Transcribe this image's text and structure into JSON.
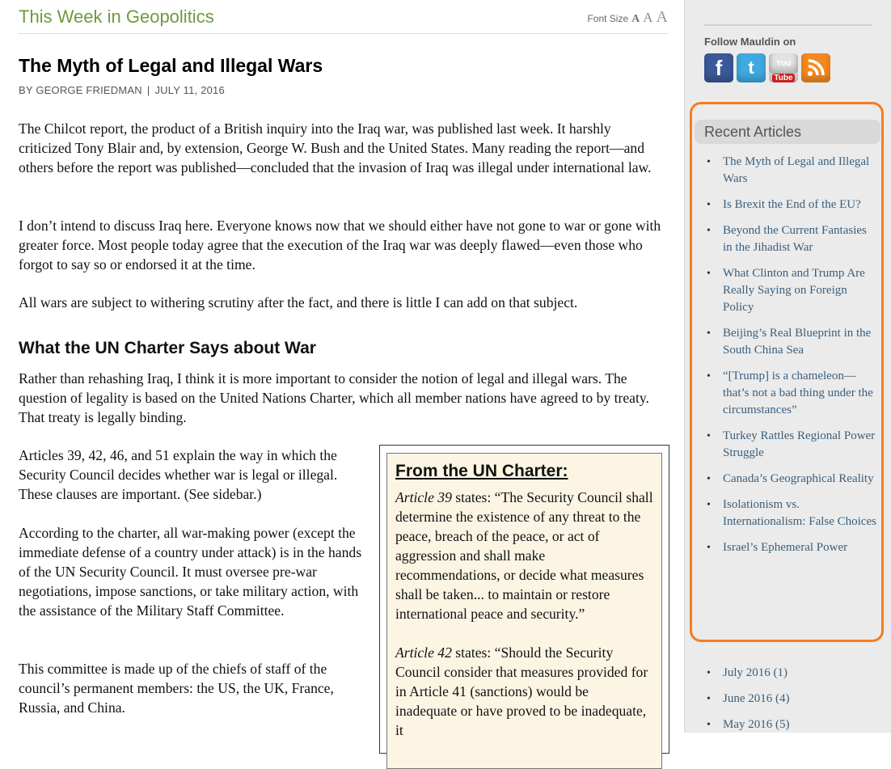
{
  "header": {
    "section_title": "This Week in Geopolitics",
    "font_size_label": "Font Size",
    "font_sizes": [
      "A",
      "A",
      "A"
    ]
  },
  "article": {
    "title": "The Myth of Legal and Illegal Wars",
    "author": "BY GEORGE FRIEDMAN",
    "date": "JULY 11, 2016",
    "paragraphs": [
      "The Chilcot report, the product of a British inquiry into the Iraq war, was published last week. It harshly criticized Tony Blair and, by extension, George W. Bush and the United States. Many reading the report—and others before the report was published—concluded that the invasion of Iraq was illegal under international law.",
      "I don’t intend to discuss Iraq here. Everyone knows now that we should either have not gone to war or gone with greater force. Most people today agree that the execution of the Iraq war was deeply flawed—even those who forgot to say so or endorsed it at the time.",
      "All wars are subject to withering scrutiny after the fact, and there is little I can add on that subject."
    ],
    "subheading": "What the UN Charter Says about War",
    "paragraphs2": [
      "Rather than rehashing Iraq, I think it is more important to consider the notion of legal and illegal wars. The question of legality is based on the United Nations Charter, which all member nations have agreed to by treaty. That treaty is legally binding.",
      "Articles 39, 42, 46, and 51 explain the way in which the Security Council decides whether war is legal or illegal. These clauses are important. (See sidebar.)",
      "According to the charter, all war-making power (except the immediate defense of a country under attack) is in the hands of the UN Security Council. It must oversee pre-war negotiations, impose sanctions, or take military action, with the assistance of the Military Staff Committee.",
      "This committee is made up of the chiefs of staff of the council’s permanent members: the US, the UK, France, Russia, and China."
    ]
  },
  "charter_box": {
    "heading": "From the UN Charter:",
    "items": [
      {
        "article": "Article 39",
        "text": " states: “The Security Council shall determine the existence of any threat to the peace, breach of the peace, or act of aggression and shall make recommendations, or decide what measures shall be taken... to maintain or restore international peace and security.”"
      },
      {
        "article": "Article 42",
        "text": " states: “Should the Security Council consider that measures provided for in Article 41 (sanctions) would be inadequate or have proved to be inadequate, it"
      }
    ]
  },
  "sidebar": {
    "follow_label": "Follow Mauldin on",
    "social_icons": [
      "facebook-icon",
      "twitter-icon",
      "youtube-icon",
      "rss-icon"
    ],
    "youtube_text": [
      "You",
      "Tube"
    ],
    "recent_title": "Recent Articles",
    "recent_articles": [
      "The Myth of Legal and Illegal Wars",
      "Is Brexit the End of the EU?",
      "Beyond the Current Fantasies in the Jihadist War",
      "What Clinton and Trump Are Really Saying on Foreign Policy",
      "Beijing’s Real Blueprint in the South China Sea",
      "“[Trump] is a chameleon—that’s not a bad thing under the circumstances”",
      "Turkey Rattles Regional Power Struggle",
      "Canada’s Geographical Reality",
      "Isolationism vs. Internationalism: False Choices",
      "Israel’s Ephemeral Power"
    ],
    "archive": [
      "July 2016 (1)",
      "June 2016 (4)",
      "May 2016 (5)"
    ],
    "highlight_color": "#f47d20"
  }
}
